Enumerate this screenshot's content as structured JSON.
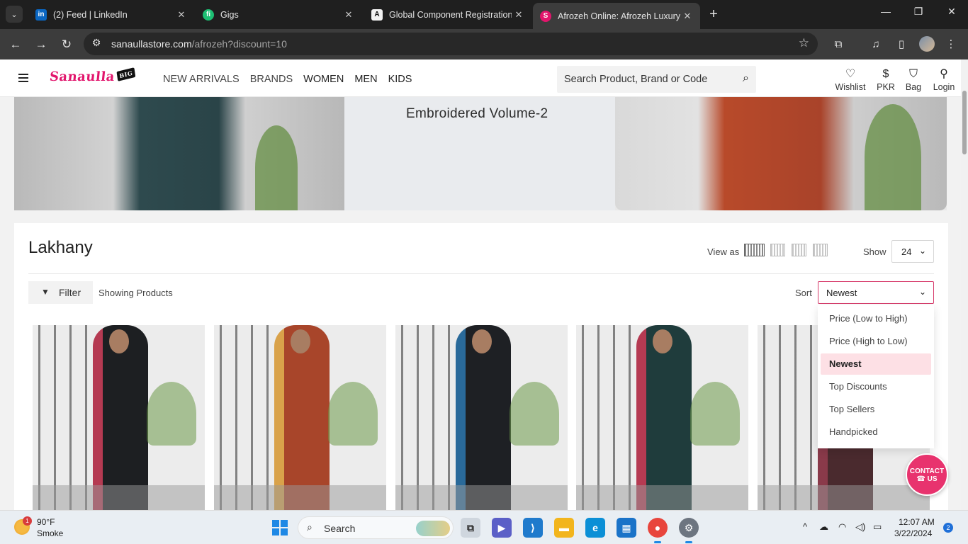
{
  "browser": {
    "tabs": [
      {
        "title": "(2) Feed | LinkedIn",
        "favicon": "linkedin-icon",
        "color": "#0a66c2",
        "glyph": "in"
      },
      {
        "title": "Gigs",
        "favicon": "fiverr-icon",
        "color": "#1dbf73",
        "glyph": "fi"
      },
      {
        "title": "Global Component Registration",
        "favicon": "arrow-a-icon",
        "color": "#111111",
        "glyph": "A"
      },
      {
        "title": "Afrozeh Online: Afrozeh Luxury",
        "favicon": "sanaulla-icon",
        "color": "#e2156c",
        "glyph": "S"
      }
    ],
    "url_host": "sanaullastore.com",
    "url_path": "/afrozeh?discount=10"
  },
  "site": {
    "logo_text": "Sanaulla",
    "logo_badge": "BIG",
    "nav": [
      "NEW ARRIVALS",
      "BRANDS",
      "WOMEN",
      "MEN",
      "KIDS"
    ],
    "search_placeholder": "Search Product, Brand or Code",
    "actions": [
      {
        "label": "Wishlist",
        "icon": "heart-icon"
      },
      {
        "label": "PKR",
        "icon": "currency-icon"
      },
      {
        "label": "Bag",
        "icon": "bag-icon"
      },
      {
        "label": "Login",
        "icon": "user-icon"
      }
    ]
  },
  "banner": {
    "title": "Embroidered Volume-2"
  },
  "listing": {
    "heading": "Lakhany",
    "view_as_label": "View as",
    "show_label": "Show",
    "show_value": "24",
    "filter_label": "Filter",
    "showing_text": "Showing Products",
    "sort_label": "Sort",
    "sort_value": "Newest",
    "sort_options": [
      "Price (Low to High)",
      "Price (High to Low)",
      "Newest",
      "Top Discounts",
      "Top Sellers",
      "Handpicked"
    ],
    "sort_selected_index": 2,
    "products": [
      {
        "outfit_color": "#1d1f22",
        "accent": "#b53a52"
      },
      {
        "outfit_color": "#a8452a",
        "accent": "#d9a24a"
      },
      {
        "outfit_color": "#1e2024",
        "accent": "#2a6a9a"
      },
      {
        "outfit_color": "#1f3c3c",
        "accent": "#b53a52"
      },
      {
        "outfit_color": "#4a2a2e",
        "accent": "#8a3a4a"
      }
    ]
  },
  "contact": {
    "line1": "CONTACT",
    "line2": "☎ US"
  },
  "taskbar": {
    "temperature": "90°F",
    "weather_desc": "Smoke",
    "weather_badge": "1",
    "search_label": "Search",
    "time": "12:07 AM",
    "date": "3/22/2024",
    "notifications": "2"
  }
}
